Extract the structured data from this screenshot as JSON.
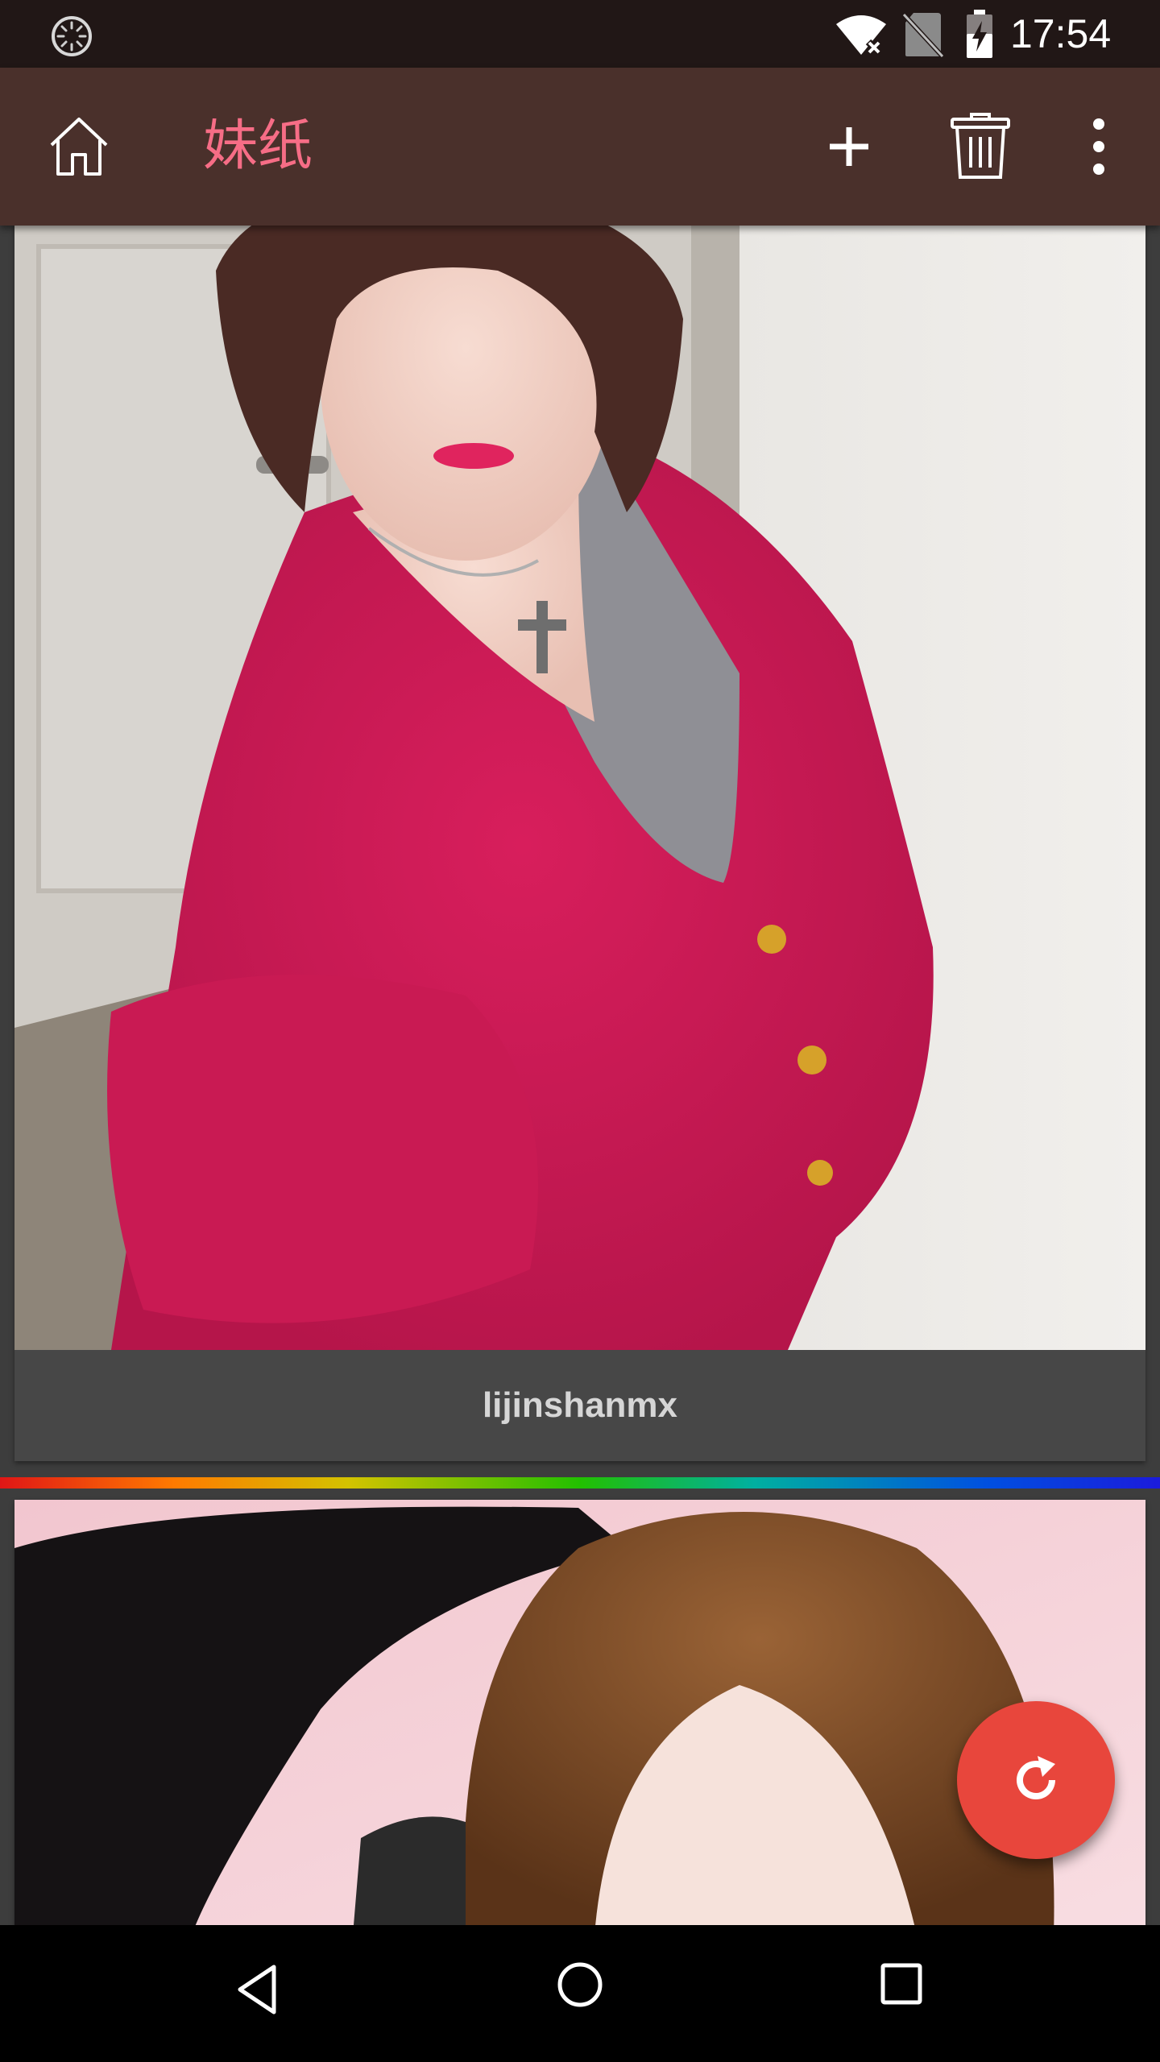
{
  "status_bar": {
    "time": "17:54",
    "icons": [
      "loading-icon",
      "wifi-off-icon",
      "no-sim-icon",
      "battery-charging-icon"
    ]
  },
  "action_bar": {
    "title": "妹纸",
    "icons": [
      "home-icon",
      "add-icon",
      "trash-icon",
      "more-vert-icon"
    ]
  },
  "feed": {
    "cards": [
      {
        "caption": "lijinshanmx"
      },
      {
        "caption": ""
      }
    ]
  },
  "fab": {
    "icon": "refresh-icon",
    "color": "#e8463c"
  },
  "nav_bar": {
    "icons": [
      "back-icon",
      "home-circle-icon",
      "recents-icon"
    ]
  },
  "colors": {
    "status_bar": "#211716",
    "action_bar": "#4a302b",
    "title": "#f66d86",
    "background": "#3d3d3d",
    "card_caption_bg": "#474747"
  }
}
